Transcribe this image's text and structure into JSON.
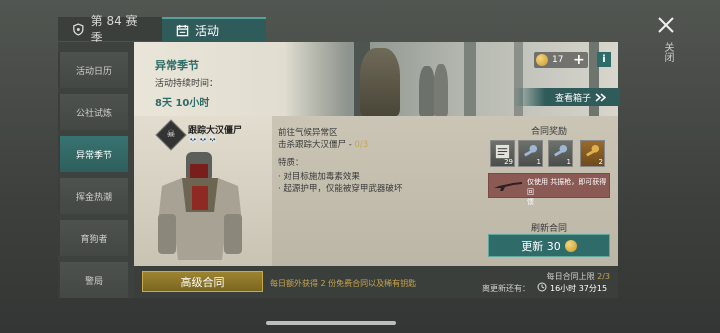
{
  "tabs": {
    "season": "第 84 赛季",
    "activity": "活动"
  },
  "close_label": "关闭",
  "sidebar": {
    "items": [
      {
        "label": "活动日历"
      },
      {
        "label": "公社试炼"
      },
      {
        "label": "异常季节"
      },
      {
        "label": "挥金热潮"
      },
      {
        "label": "育狗者"
      },
      {
        "label": "警局"
      }
    ]
  },
  "banner": {
    "title": "异常季节",
    "duration_label": "活动持续时间：",
    "duration_value": "8天 10小时",
    "coins": "17",
    "view_box": "查看箱子"
  },
  "contract": {
    "zombie_name": "跟踪大汉僵尸",
    "skulls": "💀💀💀",
    "goal_line1": "前往气候异常区",
    "goal_line2_prefix": "击杀跟踪大汉僵尸 - ",
    "goal_progress": "0/3",
    "features_label": "特质：",
    "feature1": "· 对目标施加毒素效果",
    "feature2": "· 起源护甲，仅能被穿甲武器破坏"
  },
  "rewards": {
    "title": "合同奖励",
    "items": [
      {
        "count": "29"
      },
      {
        "count": "1"
      },
      {
        "count": "1"
      },
      {
        "count": "2"
      }
    ],
    "weapon_text_line1": "仅使用 共振枪，即可获得回",
    "weapon_text_line2": "馈"
  },
  "refresh": {
    "label": "刷新合同",
    "button": "更新 30"
  },
  "bottom": {
    "advanced_button": "高级合同",
    "tip": "每日额外获得 2 份免费合同以及稀有钥匙",
    "limit_label": "每日合同上限",
    "limit_value": "2/3",
    "renew_label": "离更新还有：",
    "renew_time": "16小时 37分15"
  },
  "colors": {
    "teal": "#2f6b68",
    "gold": "#c9a64d"
  }
}
